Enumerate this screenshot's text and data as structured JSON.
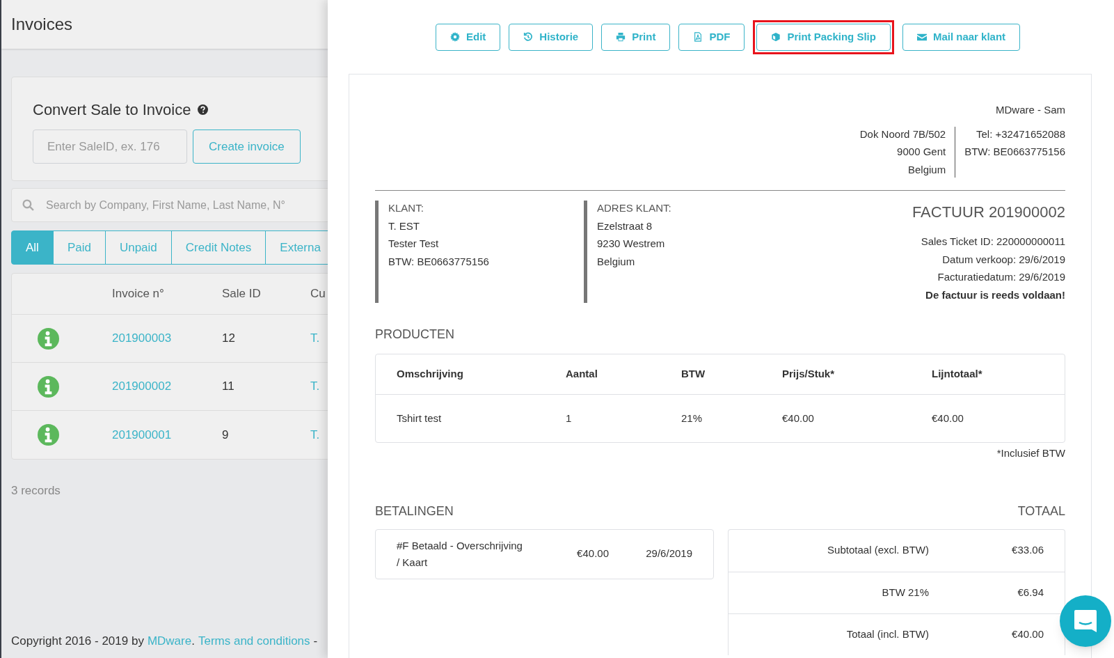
{
  "page_title": "Invoices",
  "convert": {
    "title": "Convert Sale to Invoice",
    "placeholder": "Enter SaleID, ex. 176",
    "button": "Create invoice"
  },
  "search": {
    "placeholder": "Search by Company, First Name, Last Name, N°"
  },
  "filter_tabs": [
    {
      "label": "All",
      "selected": true
    },
    {
      "label": "Paid",
      "selected": false
    },
    {
      "label": "Unpaid",
      "selected": false
    },
    {
      "label": "Credit Notes",
      "selected": false
    },
    {
      "label": "Externa",
      "selected": false
    }
  ],
  "invoice_table": {
    "columns": [
      "Invoice n°",
      "Sale ID",
      "Cu"
    ],
    "rows": [
      {
        "invoice_no": "201900003",
        "sale_id": "12",
        "column_3": "T."
      },
      {
        "invoice_no": "201900002",
        "sale_id": "11",
        "column_3": "T."
      },
      {
        "invoice_no": "201900001",
        "sale_id": "9",
        "column_3": "T."
      }
    ]
  },
  "record_count": "3 records",
  "footer": {
    "prefix": "Copyright 2016 - 2019 by",
    "brand_link": "MDware",
    "separator": ".",
    "terms_link": "Terms and conditions",
    "suffix": "-"
  },
  "toolbar": [
    {
      "label": "Edit",
      "kind": "gear",
      "highlighted": false
    },
    {
      "label": "Historie",
      "kind": "history",
      "highlighted": false
    },
    {
      "label": "Print",
      "kind": "printer",
      "highlighted": false
    },
    {
      "label": "PDF",
      "kind": "pdf",
      "highlighted": false
    },
    {
      "label": "Print Packing Slip",
      "kind": "box",
      "highlighted": true
    },
    {
      "label": "Mail naar klant",
      "kind": "mail",
      "highlighted": false
    }
  ],
  "invoice": {
    "company_name": "MDware - Sam",
    "address_lines": [
      "Dok Noord 7B/502",
      "9000 Gent",
      "Belgium"
    ],
    "contact_lines": [
      "Tel: +32471652088",
      "BTW: BE0663775156"
    ],
    "client": {
      "label": "KLANT:",
      "lines": [
        "T. EST",
        "Tester Test",
        "BTW: BE0663775156"
      ]
    },
    "client_address": {
      "label": "ADRES KLANT:",
      "lines": [
        "Ezelstraat 8",
        "9230 Westrem",
        "Belgium"
      ]
    },
    "title": "FACTUUR 201900002",
    "meta_lines": [
      "Sales Ticket ID: 220000000011",
      "Datum verkoop: 29/6/2019",
      "Facturatiedatum: 29/6/2019"
    ],
    "paid_note": "De factuur is reeds voldaan!",
    "products": {
      "heading": "PRODUCTEN",
      "columns": [
        "Omschrijving",
        "Aantal",
        "BTW",
        "Prijs/Stuk*",
        "Lijntotaal*"
      ],
      "rows": [
        [
          "Tshirt test",
          "1",
          "21%",
          "€40.00",
          "€40.00"
        ]
      ],
      "note": "*Inclusief BTW"
    },
    "payments": {
      "heading": "BETALINGEN",
      "rows": [
        {
          "description": "#F Betaald - Overschrijving / Kaart",
          "amount": "€40.00",
          "date": "29/6/2019"
        }
      ]
    },
    "totals": {
      "heading": "TOTAAL",
      "rows": [
        {
          "label": "Subtotaal (excl. BTW)",
          "value": "€33.06"
        },
        {
          "label": "BTW 21%",
          "value": "€6.94"
        },
        {
          "label": "Totaal (incl. BTW)",
          "value": "€40.00"
        }
      ]
    }
  }
}
